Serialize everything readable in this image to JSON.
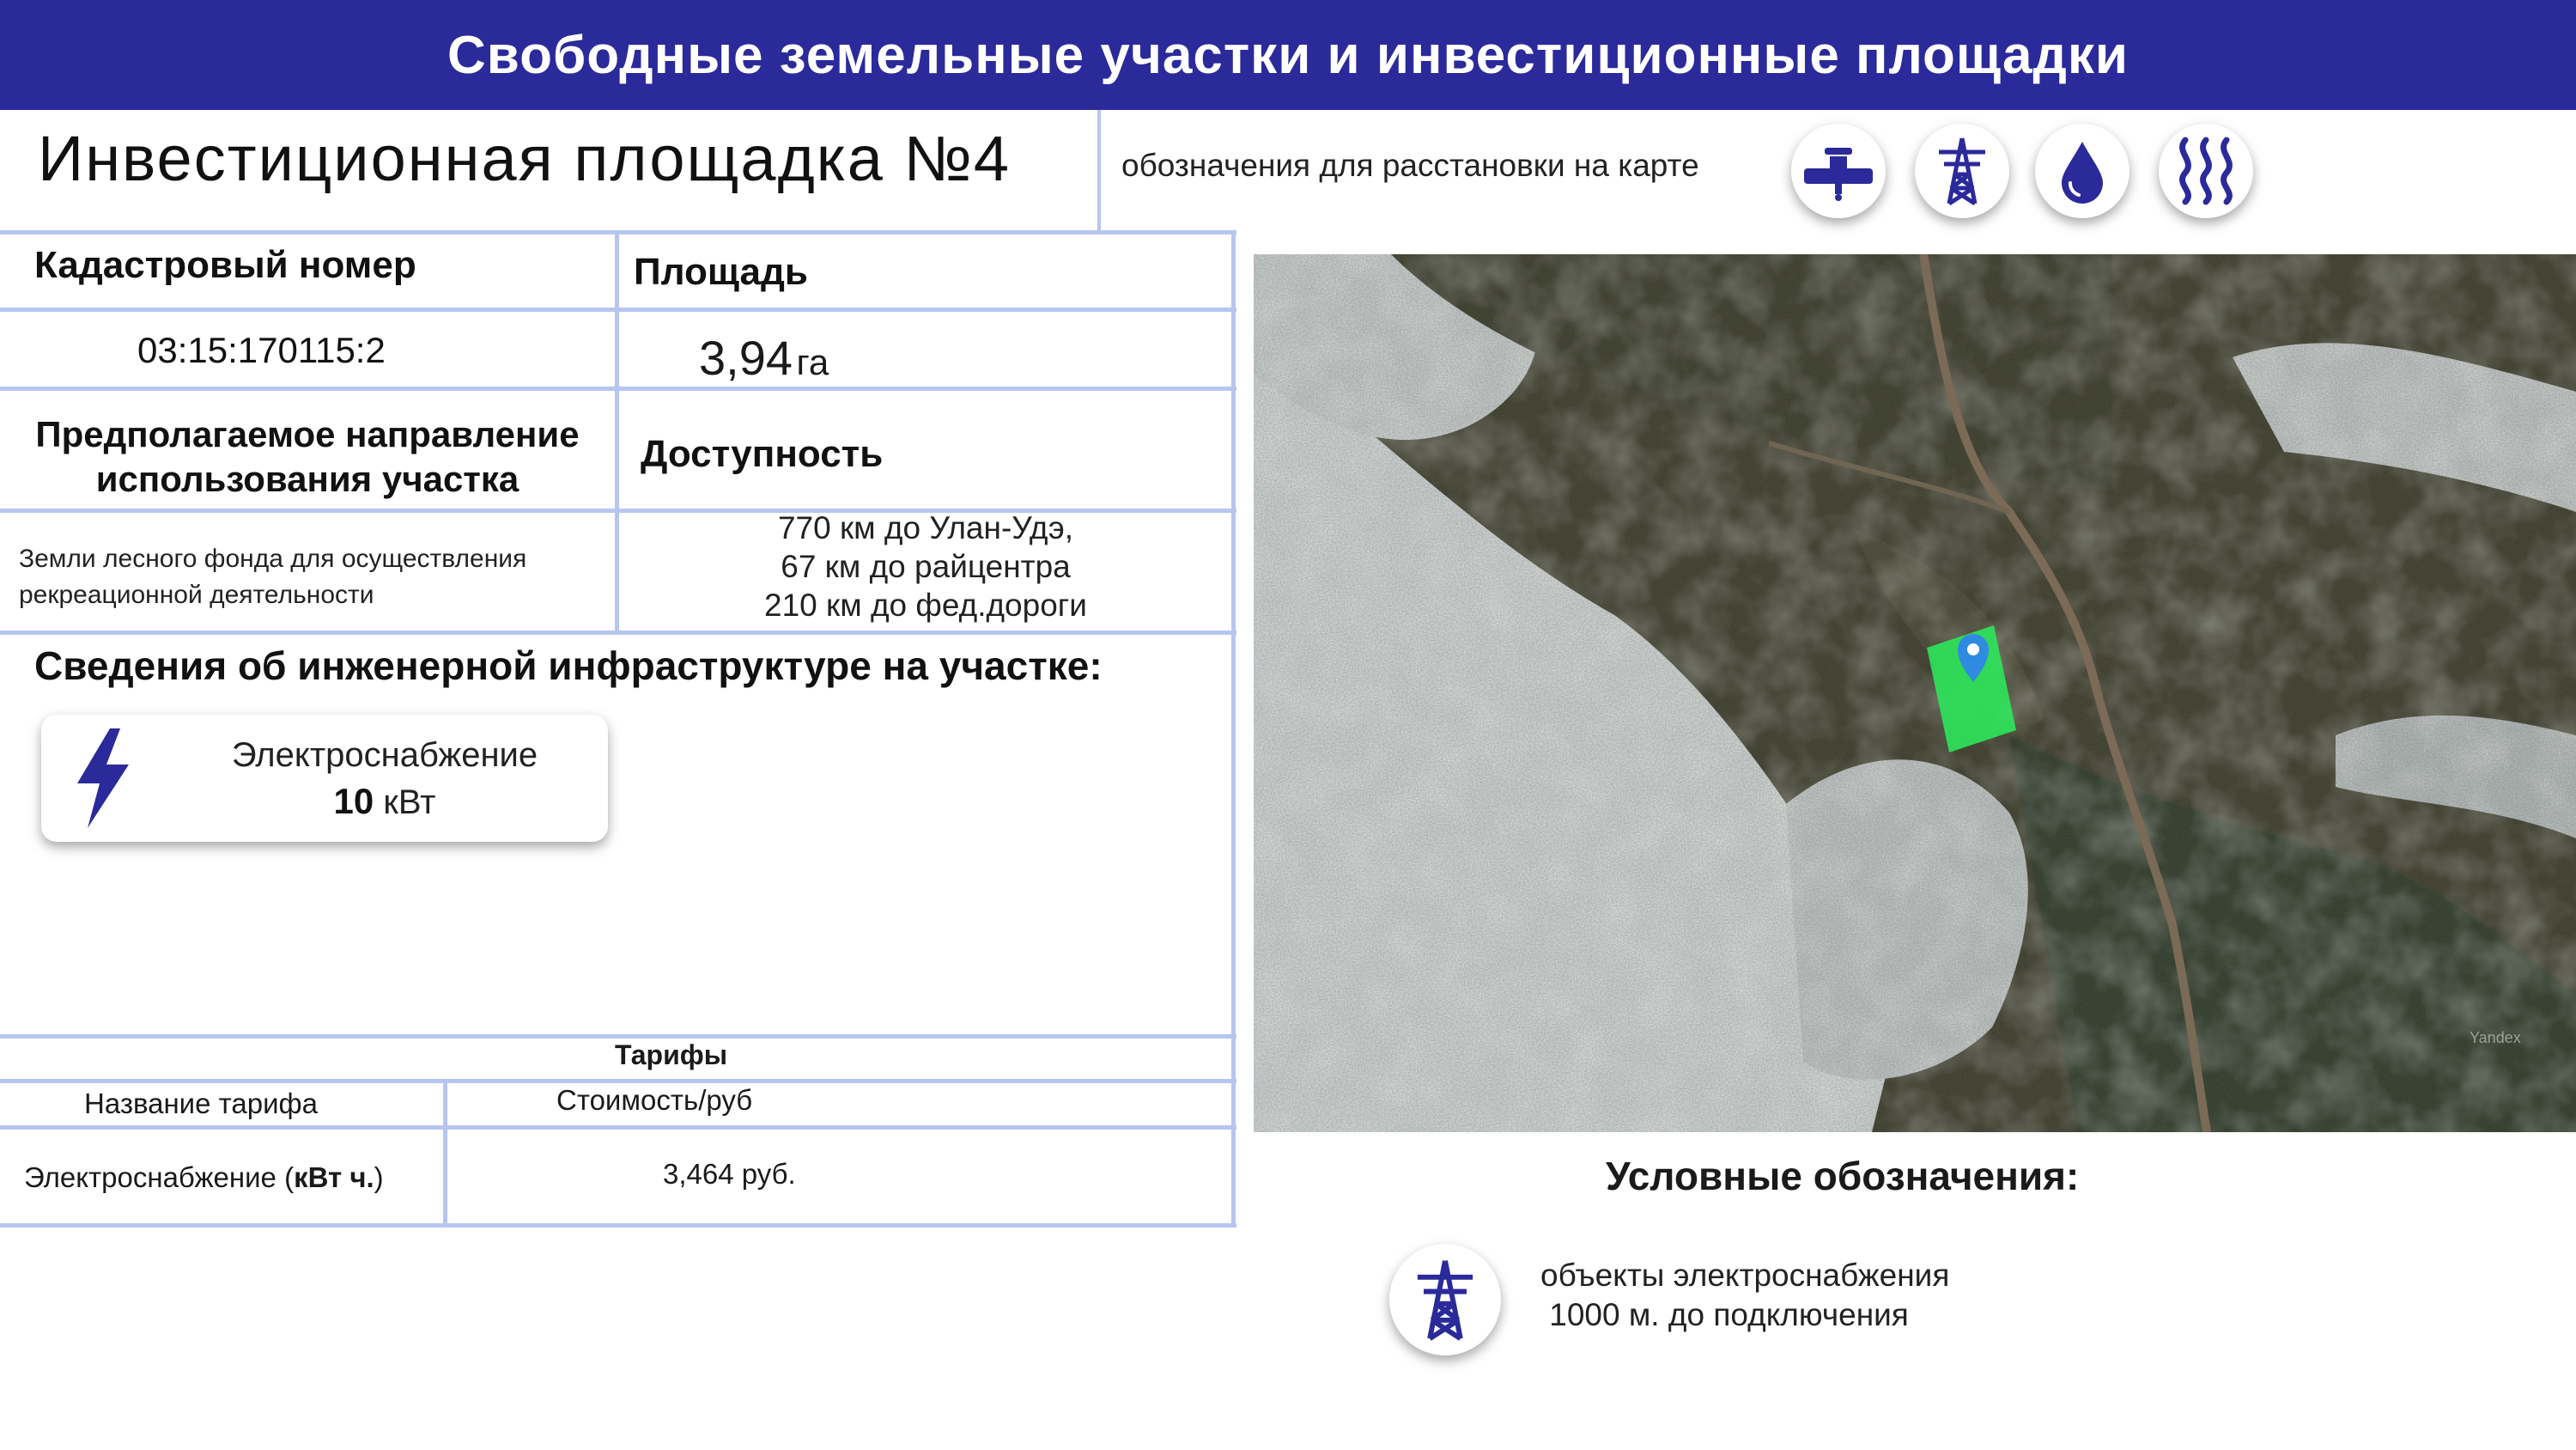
{
  "header": {
    "title": "Свободные земельные участки и инвестиционные площадки"
  },
  "site": {
    "title": "Инвестиционная площадка  №4",
    "legend_note": "обозначения для расстановки на карте",
    "legend_icons": [
      "water-pipe-icon",
      "power-tower-icon",
      "water-drop-icon",
      "heat-icon"
    ]
  },
  "info": {
    "cadastre_label": "Кадастровый номер",
    "cadastre_value": "03:15:170115:2",
    "area_label": "Площадь",
    "area_value": "3,94",
    "area_unit": "га",
    "purpose_label_1": "Предполагаемое направление",
    "purpose_label_2": "использования участка",
    "purpose_value_1": "Земли лесного фонда для осуществления",
    "purpose_value_2": "рекреационной деятельности",
    "access_label": "Доступность",
    "access_lines": [
      "770 км до Улан-Удэ,",
      "67 км до райцентра",
      "210 км до фед.дороги"
    ]
  },
  "infrastructure": {
    "title": "Сведения об инженерной инфраструктуре на участке:",
    "items": [
      {
        "name": "Электроснабжение",
        "value": "10",
        "unit": "кВт",
        "icon": "lightning-icon"
      }
    ]
  },
  "tariffs": {
    "title": "Тарифы",
    "col_name": "Название тарифа",
    "col_cost": "Стоимость/руб",
    "rows": [
      {
        "name": "Электроснабжение (",
        "name_bold": "кВт ч.",
        "name_end": ")",
        "cost": "3,464 руб."
      }
    ]
  },
  "map": {
    "watermark": "Yandex",
    "plot_color": "#2ee65a",
    "pin_color": "#2f8be0"
  },
  "legend": {
    "title": "Условные обозначения:",
    "items": [
      {
        "icon": "power-tower-icon",
        "line1": "объекты электроснабжения",
        "line2": " 1000 м. до подключения"
      }
    ]
  },
  "colors": {
    "header_bg": "#2b2a9a",
    "accent": "#2b2a9a",
    "table_lines": "#b7c6ef"
  }
}
